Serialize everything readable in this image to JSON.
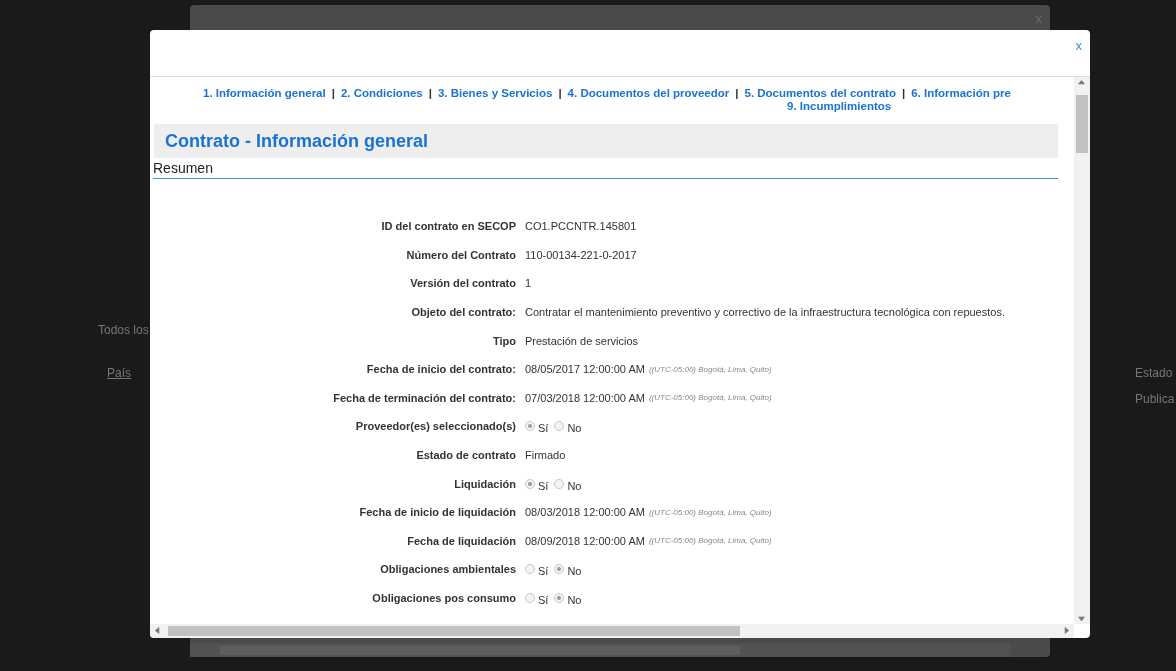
{
  "background": {
    "texts": [
      "Todos los",
      "País",
      "Estado",
      "Publica"
    ]
  },
  "modal": {
    "close": "x",
    "back_close": "x",
    "nav": {
      "links": [
        "1. Información general",
        "2. Condiciones",
        "3. Bienes y Servicios",
        "4. Documentos del proveedor",
        "5. Documentos del contrato",
        "6. Información pre"
      ],
      "separator": "|",
      "second_line": "9. Incumplimientos"
    },
    "title": "Contrato - Información general",
    "section": "Resumen",
    "fields": [
      {
        "kind": "text",
        "label": "ID del contrato en SECOP",
        "value": "CO1.PCCNTR.145801"
      },
      {
        "kind": "text",
        "label": "Número del Contrato",
        "value": "110-00134-221-0-2017"
      },
      {
        "kind": "text",
        "label": "Versión del contrato",
        "value": "1"
      },
      {
        "kind": "text",
        "label": "Objeto del contrato:",
        "value": "Contratar el mantenimiento preventivo y correctivo de la infraestructura tecnológica con repuestos."
      },
      {
        "kind": "text",
        "label": "Tipo",
        "value": "Prestación de servicios"
      },
      {
        "kind": "date",
        "label": "Fecha de inicio del contrato:",
        "value": "08/05/2017 12:00:00 AM",
        "zone": "((UTC-05:00) Bogotá, Lima, Quito)"
      },
      {
        "kind": "date",
        "label": "Fecha de terminación del contrato:",
        "value": "07/03/2018 12:00:00 AM",
        "zone": "((UTC-05:00) Bogotá, Lima, Quito)"
      },
      {
        "kind": "radio",
        "label": "Proveedor(es) seleccionado(s)",
        "options": [
          {
            "label": "Sí",
            "selected": true
          },
          {
            "label": "No",
            "selected": false
          }
        ]
      },
      {
        "kind": "text",
        "label": "Estado de contrato",
        "value": "Firmado"
      },
      {
        "kind": "radio",
        "label": "Liquidación",
        "options": [
          {
            "label": "Sí",
            "selected": true
          },
          {
            "label": "No",
            "selected": false
          }
        ]
      },
      {
        "kind": "date",
        "label": "Fecha de inicio de liquidación",
        "value": "08/03/2018 12:00:00 AM",
        "zone": "((UTC-05:00) Bogotá, Lima, Quito)"
      },
      {
        "kind": "date",
        "label": "Fecha de liquidación",
        "value": "08/09/2018 12:00:00 AM",
        "zone": "((UTC-05:00) Bogotá, Lima, Quito)"
      },
      {
        "kind": "radio",
        "label": "Obligaciones ambientales",
        "options": [
          {
            "label": "Sí",
            "selected": false
          },
          {
            "label": "No",
            "selected": true
          }
        ]
      },
      {
        "kind": "radio",
        "label": "Obligaciones pos consumo",
        "options": [
          {
            "label": "Sí",
            "selected": false
          },
          {
            "label": "No",
            "selected": true
          }
        ]
      }
    ]
  }
}
